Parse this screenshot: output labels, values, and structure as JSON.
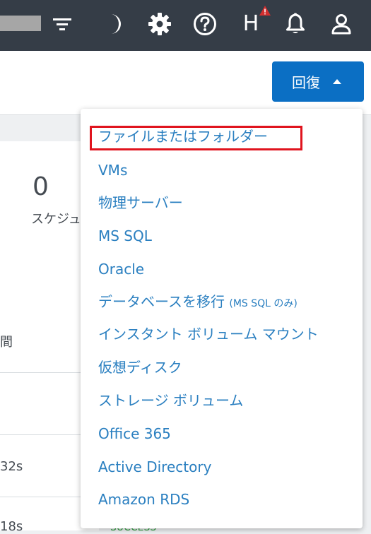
{
  "header": {
    "icons": [
      "filter-icon",
      "moon-icon",
      "gear-icon",
      "help-icon",
      "h-icon",
      "bell-icon",
      "user-icon"
    ],
    "h_label": "H",
    "alert_color": "#d32f2f"
  },
  "toolbar": {
    "recover_label": "回復"
  },
  "card": {
    "value": "0",
    "label": "スケジュ",
    "row_label": "間",
    "row1_value": "32s",
    "row2_value": "18s"
  },
  "status_fragment": "SUCCESS",
  "menu": {
    "items": [
      {
        "label": "ファイルまたはフォルダー"
      },
      {
        "label": "VMs"
      },
      {
        "label": "物理サーバー"
      },
      {
        "label": "MS SQL"
      },
      {
        "label": "Oracle"
      },
      {
        "label": "データベースを移行 ",
        "suffix": "(MS SQL のみ)"
      },
      {
        "label": "インスタント ボリューム マウント"
      },
      {
        "label": "仮想ディスク"
      },
      {
        "label": "ストレージ ボリューム"
      },
      {
        "label": "Office 365"
      },
      {
        "label": "Active Directory"
      },
      {
        "label": "Amazon RDS"
      }
    ],
    "highlighted_index": 0,
    "link_color": "#2a7fc0",
    "highlight_color": "#e0141e"
  }
}
